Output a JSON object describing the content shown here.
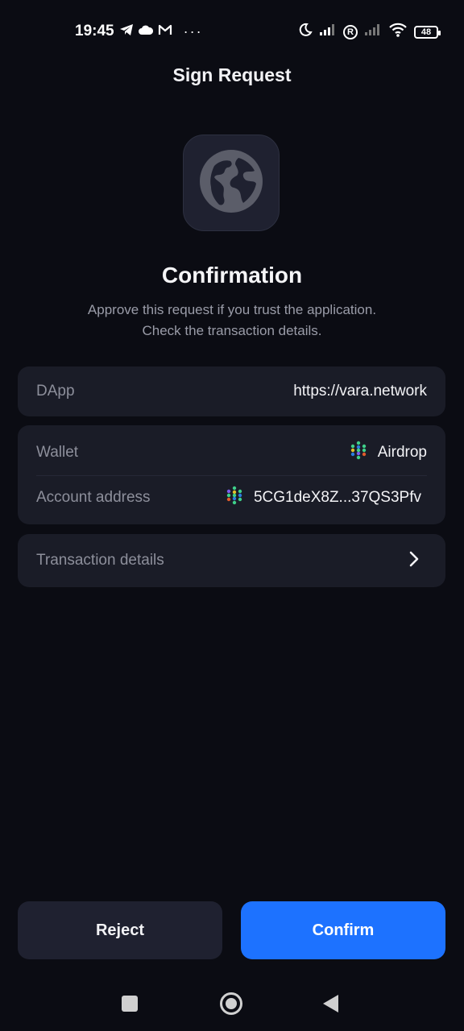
{
  "status_bar": {
    "time": "19:45",
    "more": "···",
    "battery": "48",
    "icons": [
      "telegram-icon",
      "cloud-icon",
      "gmail-icon",
      "moon-icon",
      "signal-icon",
      "registered-icon",
      "wifi-icon",
      "battery-icon"
    ]
  },
  "header": {
    "title": "Sign Request"
  },
  "app_icon": {
    "icon": "globe-icon",
    "bg": "#1f2130"
  },
  "confirmation": {
    "title": "Confirmation",
    "subtitle_line1": "Approve this request if you trust the application.",
    "subtitle_line2": "Check the transaction details."
  },
  "dapp": {
    "label": "DApp",
    "value": "https://vara.network"
  },
  "wallet": {
    "label": "Wallet",
    "value": "Airdrop",
    "address_label": "Account address",
    "address_value": "5CG1deX8Z...37QS3Pfv"
  },
  "transaction": {
    "label": "Transaction details"
  },
  "actions": {
    "reject": "Reject",
    "confirm": "Confirm"
  },
  "colors": {
    "background": "#0b0c13",
    "card": "#1a1c27",
    "accent": "#1d72ff"
  }
}
